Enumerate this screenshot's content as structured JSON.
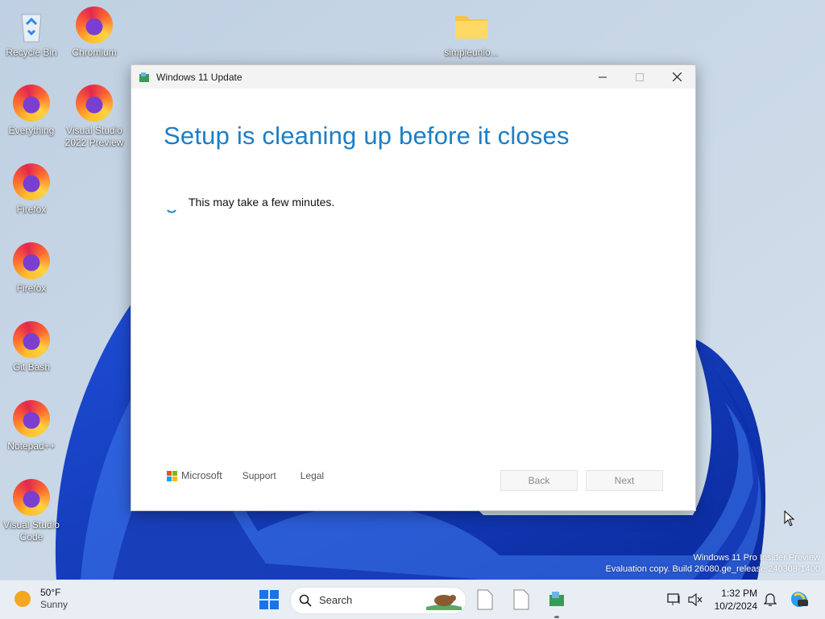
{
  "desktop": {
    "icons": [
      {
        "label": "Recycle Bin"
      },
      {
        "label": "Chromium"
      },
      {
        "label": "simpleunlo..."
      },
      {
        "label": "Everything"
      },
      {
        "label": "Visual Studio 2022 Preview"
      },
      {
        "label": "Firefox"
      },
      {
        "label": "Firefox"
      },
      {
        "label": "Git Bash"
      },
      {
        "label": "Notepad++"
      },
      {
        "label": "Visual Studio Code"
      }
    ],
    "watermark": {
      "line1": "Windows 11 Pro Insider Preview",
      "line2": "Evaluation copy. Build 26080.ge_release.240308-1400"
    }
  },
  "window": {
    "title": "Windows 11 Update",
    "heading": "Setup is cleaning up before it closes",
    "message": "This may take a few minutes.",
    "footer": {
      "brand": "Microsoft",
      "support": "Support",
      "legal": "Legal",
      "back": "Back",
      "next": "Next"
    }
  },
  "taskbar": {
    "weather": {
      "temp": "50°F",
      "condition": "Sunny"
    },
    "search_placeholder": "Search",
    "clock": {
      "time": "1:32 PM",
      "date": "10/2/2024"
    }
  },
  "colors": {
    "heading": "#1c7ec6",
    "taskbar": "#e9eef4"
  }
}
